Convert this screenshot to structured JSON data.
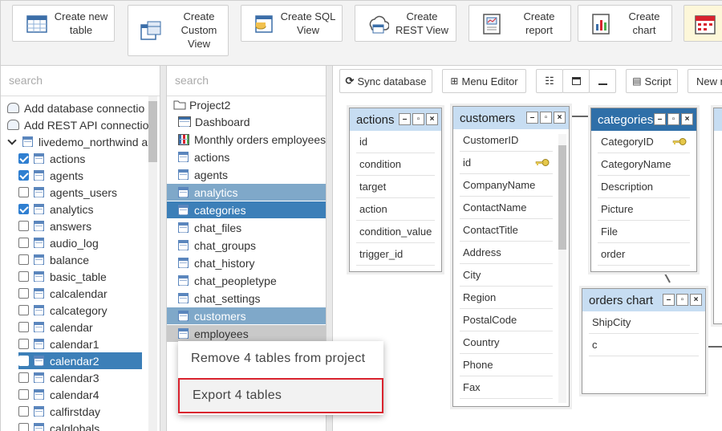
{
  "toolbar": {
    "buttons": [
      {
        "label": "Create new\ntable",
        "icon": "table-icon"
      },
      {
        "label": "Create\nCustom\nView",
        "icon": "custom-view-icon"
      },
      {
        "label": "Create SQL\nView",
        "icon": "sql-view-icon"
      },
      {
        "label": "Create\nREST View",
        "icon": "rest-view-icon"
      },
      {
        "label": "Create\nreport",
        "icon": "report-icon"
      },
      {
        "label": "Create\nchart",
        "icon": "chart-icon"
      }
    ]
  },
  "left_panel": {
    "search_placeholder": "search",
    "items": [
      {
        "label": "Add database connectio"
      },
      {
        "label": "Add REST API connectio"
      },
      {
        "label": "livedemo_northwind a"
      },
      {
        "label": "actions",
        "checked": true
      },
      {
        "label": "agents",
        "checked": true
      },
      {
        "label": "agents_users",
        "checked": false
      },
      {
        "label": "analytics",
        "checked": true
      },
      {
        "label": "answers",
        "checked": false
      },
      {
        "label": "audio_log",
        "checked": false
      },
      {
        "label": "balance",
        "checked": false
      },
      {
        "label": "basic_table",
        "checked": false
      },
      {
        "label": "calcalendar",
        "checked": false
      },
      {
        "label": "calcategory",
        "checked": false
      },
      {
        "label": "calendar",
        "checked": false
      },
      {
        "label": "calendar1",
        "checked": false
      },
      {
        "label": "calendar2",
        "checked": false,
        "selected": true
      },
      {
        "label": "calendar3",
        "checked": false
      },
      {
        "label": "calendar4",
        "checked": false
      },
      {
        "label": "calfirstday",
        "checked": false
      },
      {
        "label": "calglobals",
        "checked": false
      }
    ]
  },
  "mid_panel": {
    "search_placeholder": "search",
    "project": "Project2",
    "items": [
      {
        "label": "Dashboard",
        "kind": "dashboard"
      },
      {
        "label": "Monthly orders employees",
        "kind": "report"
      },
      {
        "label": "actions",
        "kind": "table"
      },
      {
        "label": "agents",
        "kind": "table"
      },
      {
        "label": "analytics",
        "kind": "table",
        "state": "hl"
      },
      {
        "label": "categories",
        "kind": "table",
        "state": "sel"
      },
      {
        "label": "chat_files",
        "kind": "table"
      },
      {
        "label": "chat_groups",
        "kind": "table"
      },
      {
        "label": "chat_history",
        "kind": "table"
      },
      {
        "label": "chat_peopletype",
        "kind": "table"
      },
      {
        "label": "chat_settings",
        "kind": "table"
      },
      {
        "label": "customers",
        "kind": "table",
        "state": "hl"
      },
      {
        "label": "employees",
        "kind": "table",
        "state": "gray"
      }
    ]
  },
  "context_menu": {
    "remove": "Remove 4 tables from project",
    "export": "Export 4 tables"
  },
  "canvas": {
    "tools": {
      "sync": "Sync database",
      "menu_editor": "Menu Editor",
      "script": "Script",
      "new": "New r"
    },
    "tables": {
      "actions": {
        "title": "actions",
        "fields": [
          "id",
          "condition",
          "target",
          "action",
          "condition_value",
          "trigger_id"
        ]
      },
      "customers": {
        "title": "customers",
        "fields": [
          "CustomerID",
          "id",
          "CompanyName",
          "ContactName",
          "ContactTitle",
          "Address",
          "City",
          "Region",
          "PostalCode",
          "Country",
          "Phone",
          "Fax"
        ]
      },
      "categories": {
        "title": "categories",
        "fields": [
          "CategoryID",
          "CategoryName",
          "Description",
          "Picture",
          "File",
          "order"
        ]
      },
      "orders_chart": {
        "title": "orders chart",
        "fields": [
          "ShipCity",
          "c"
        ]
      }
    }
  }
}
